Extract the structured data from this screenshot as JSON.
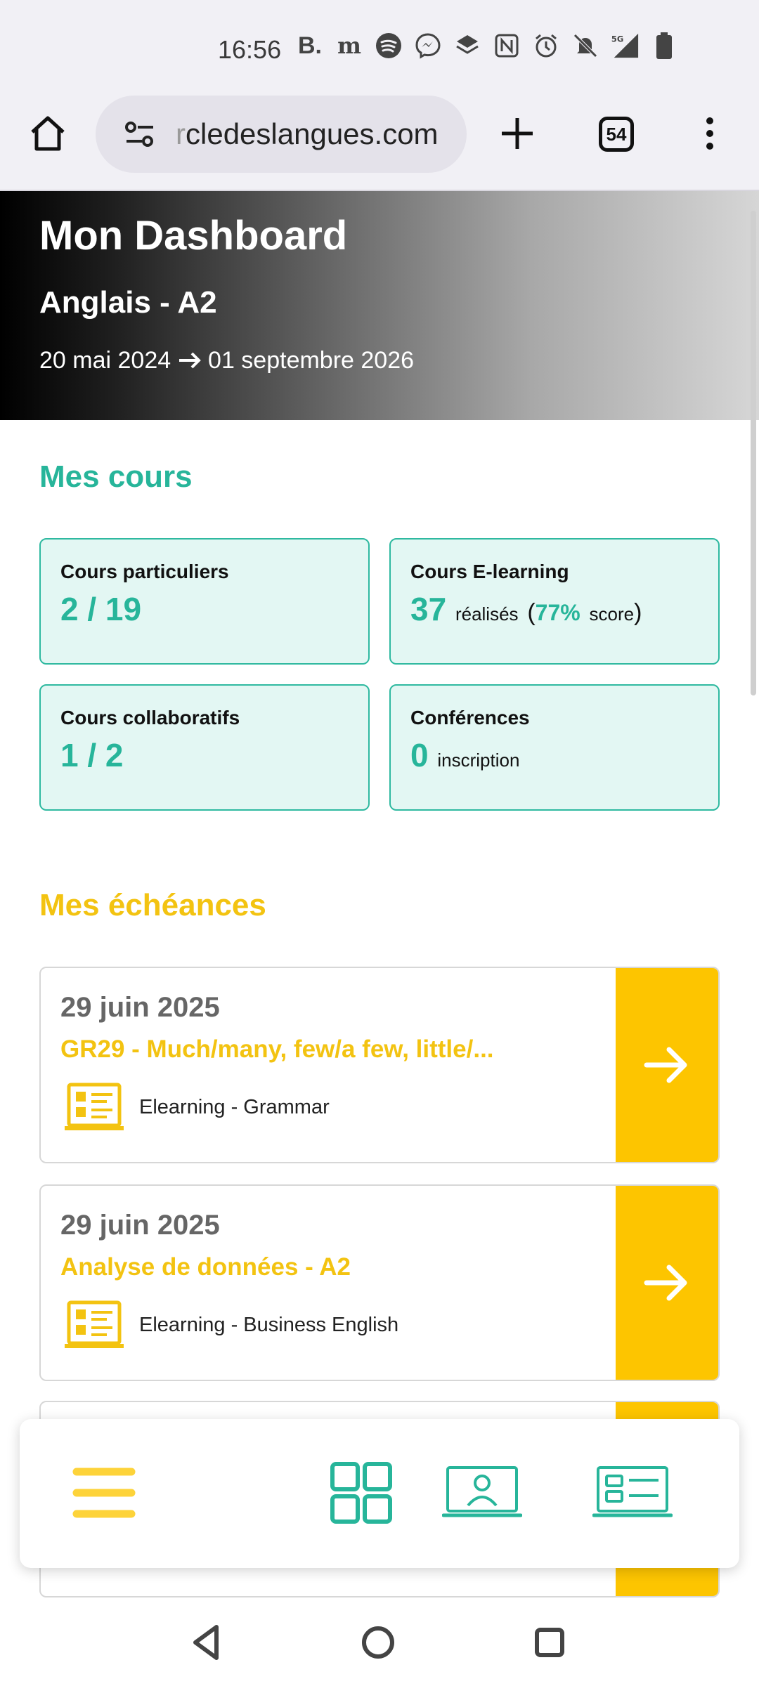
{
  "status_bar": {
    "time": "16:56",
    "icons": [
      "booking-b-icon",
      "newspaper-icon",
      "spotify-icon",
      "messenger-icon",
      "layers-icon",
      "nfc-icon",
      "alarm-icon",
      "bell-off-icon",
      "signal-5g-icon",
      "battery-icon"
    ]
  },
  "browser": {
    "url_faded": "r",
    "url": "cledeslangues.com",
    "tab_count": "54"
  },
  "header": {
    "title": "Mon Dashboard",
    "subtitle": "Anglais - A2",
    "date_start": "20 mai 2024",
    "date_end": "01 septembre 2026"
  },
  "courses": {
    "title": "Mes cours",
    "cards": [
      {
        "label": "Cours particuliers",
        "value": "2 / 19"
      },
      {
        "label": "Cours E-learning",
        "value": "37",
        "suffix": "réalisés",
        "score_pct": "77%",
        "score_word": "score"
      },
      {
        "label": "Cours collaboratifs",
        "value": "1 / 2"
      },
      {
        "label": "Conférences",
        "value": "0",
        "suffix": "inscription"
      }
    ]
  },
  "deadlines": {
    "title": "Mes échéances",
    "items": [
      {
        "date": "29 juin 2025",
        "title": "GR29 - Much/many, few/a few, little/...",
        "type": "Elearning - Grammar"
      },
      {
        "date": "29 juin 2025",
        "title": "Analyse de données - A2",
        "type": "Elearning - Business English"
      }
    ]
  },
  "colors": {
    "accent_green": "#27b59a",
    "accent_yellow": "#fdc500",
    "card_bg": "#e3f7f3"
  }
}
